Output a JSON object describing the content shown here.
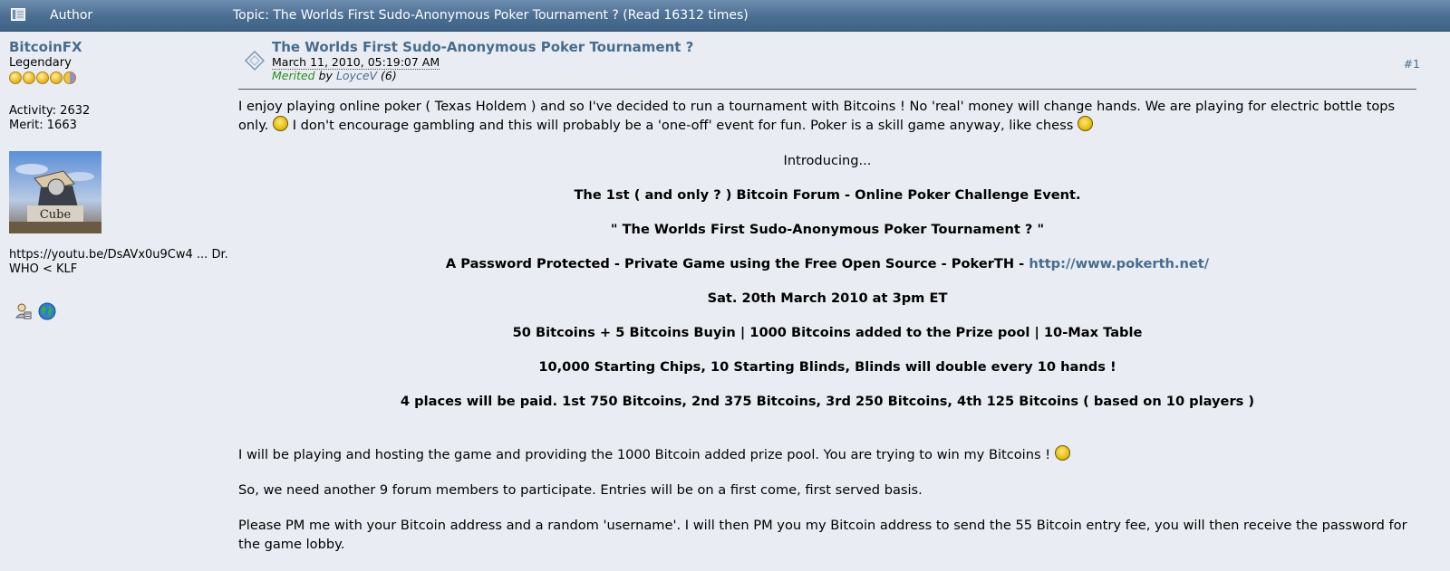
{
  "header": {
    "author_label": "Author",
    "topic_label": "Topic: The Worlds First Sudo-Anonymous Poker Tournament ?  (Read 16312 times)"
  },
  "poster": {
    "name": "BitcoinFX",
    "rank": "Legendary",
    "activity": "Activity: 2632",
    "merit": "Merit: 1663",
    "signature": "https://youtu.be/DsAVx0u9Cw4 ... Dr. WHO < KLF",
    "icons": [
      "profile-icon",
      "website-globe-icon"
    ]
  },
  "post": {
    "title": "The Worlds First Sudo-Anonymous Poker Tournament ?",
    "date": "March 11, 2010, 05:19:07 AM",
    "merited_label": "Merited",
    "by_label": "by",
    "merited_by": "LoyceV",
    "merit_count": "(6)",
    "number": "#1",
    "p1_a": "I enjoy playing online poker ( Texas Holdem ) and so I've decided to run a tournament with Bitcoins ! No 'real' money will change hands. We are playing for electric bottle tops only.",
    "p1_b": "I don't encourage gambling and this will probably be a 'one-off' event for fun. Poker is a skill game anyway, like chess",
    "introducing": "Introducing...",
    "line1": "The 1st ( and only ? ) Bitcoin Forum - Online Poker Challenge Event.",
    "line2": "\" The Worlds First Sudo-Anonymous Poker Tournament ? \"",
    "line3_text": "A Password Protected - Private Game using the Free Open Source - PokerTH -",
    "line3_link": "http://www.pokerth.net/",
    "line4": "Sat. 20th March 2010 at 3pm ET",
    "line5": "50 Bitcoins + 5 Bitcoins Buyin | 1000 Bitcoins added to the Prize pool | 10-Max Table",
    "line6": "10,000 Starting Chips, 10 Starting Blinds, Blinds will double every 10 hands !",
    "line7": "4 places will be paid. 1st 750 Bitcoins, 2nd 375 Bitcoins, 3rd 250 Bitcoins, 4th 125 Bitcoins ( based on 10 players )",
    "p2": "I will be playing and hosting the game and providing the 1000 Bitcoin added prize pool. You are trying to win my Bitcoins !",
    "p3": "So, we need another 9 forum members to participate. Entries will be on a first come, first served basis.",
    "p4": "Please PM me with your Bitcoin address and a random 'username'. I will then PM you my Bitcoin address to send the 55 Bitcoin entry fee, you will then receive the password for the game lobby."
  },
  "colors": {
    "header_bg": "#4a6d92",
    "link": "#476c8e",
    "merited": "#2d8a1b",
    "page_bg": "#e9edf3"
  }
}
